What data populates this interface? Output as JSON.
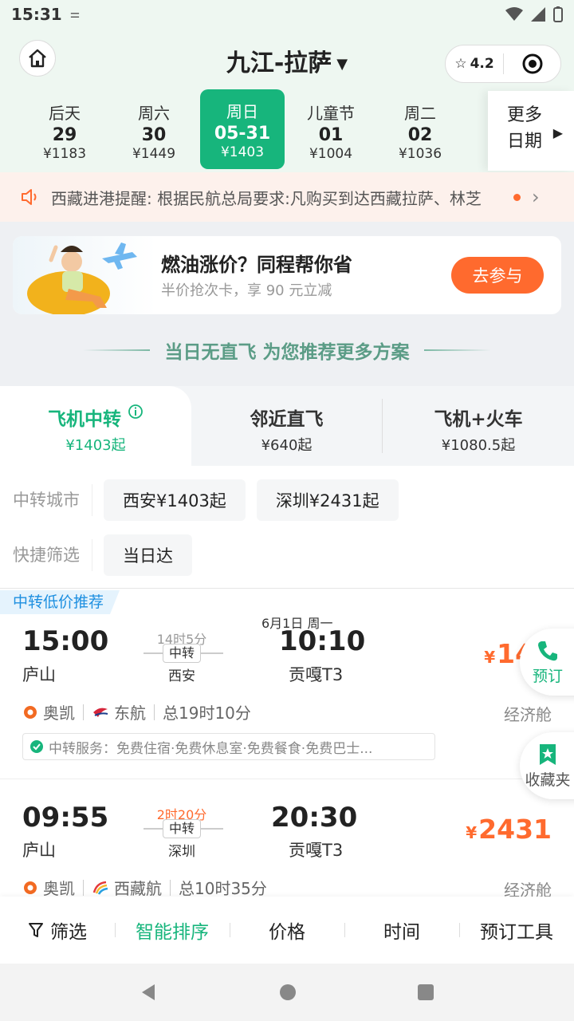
{
  "status": {
    "time": "15:31"
  },
  "header": {
    "title": "九江-拉萨",
    "rating": "4.2"
  },
  "dates": [
    {
      "weekday": "后天",
      "day": "29",
      "price": "¥1183"
    },
    {
      "weekday": "周六",
      "day": "30",
      "price": "¥1449"
    },
    {
      "weekday": "周日",
      "day": "05-31",
      "price": "¥1403",
      "active": true
    },
    {
      "weekday": "儿童节",
      "day": "01",
      "price": "¥1004"
    },
    {
      "weekday": "周二",
      "day": "02",
      "price": "¥1036"
    }
  ],
  "more_dates": {
    "line1": "更多",
    "line2": "日期"
  },
  "notice": {
    "text": "西藏进港提醒: 根据民航总局要求:凡购买到达西藏拉萨、林芝"
  },
  "promo": {
    "title": "燃油涨价？同程帮你省",
    "subtitle": "半价抢次卡，享 90 元立减",
    "button": "去参与"
  },
  "no_direct": {
    "text": "当日无直飞 为您推荐更多方案"
  },
  "plans": [
    {
      "name": "飞机中转",
      "price": "¥1403起"
    },
    {
      "name": "邻近直飞",
      "price": "¥640起"
    },
    {
      "name": "飞机+火车",
      "price": "¥1080.5起"
    }
  ],
  "filters": {
    "transfer_label": "中转城市",
    "transfer_chips": [
      "西安¥1403起",
      "深圳¥2431起"
    ],
    "quick_label": "快捷筛选",
    "quick_chips": [
      "当日达"
    ]
  },
  "list": {
    "tag": "中转低价推荐",
    "flights": [
      {
        "dep_time": "15:00",
        "dep_airport": "庐山",
        "duration": "14时5分",
        "transfer": "中转",
        "via": "西安",
        "next_day": "6月1日 周一",
        "arr_time": "10:10",
        "arr_airport": "贡嘎T3",
        "price": "140",
        "airline1": "奥凯",
        "airline2": "东航",
        "total": "总19时10分",
        "cabin": "经济舱",
        "service": "中转服务：免费住宿·免费休息室·免费餐食·免费巴士..."
      },
      {
        "dep_time": "09:55",
        "dep_airport": "庐山",
        "duration": "2时20分",
        "transfer": "中转",
        "via": "深圳",
        "arr_time": "20:30",
        "arr_airport": "贡嘎T3",
        "price": "2431",
        "airline1": "奥凯",
        "airline2": "西藏航",
        "total": "总10时35分",
        "cabin": "经济舱"
      }
    ]
  },
  "float": {
    "book": "预订",
    "fav": "收藏夹"
  },
  "bottom": [
    "筛选",
    "智能排序",
    "价格",
    "时间",
    "预订工具"
  ],
  "currency_symbol": "¥",
  "colors": {
    "brand_green": "#17b57c",
    "orange": "#ff6a2e",
    "blue": "#1d8fe0"
  }
}
